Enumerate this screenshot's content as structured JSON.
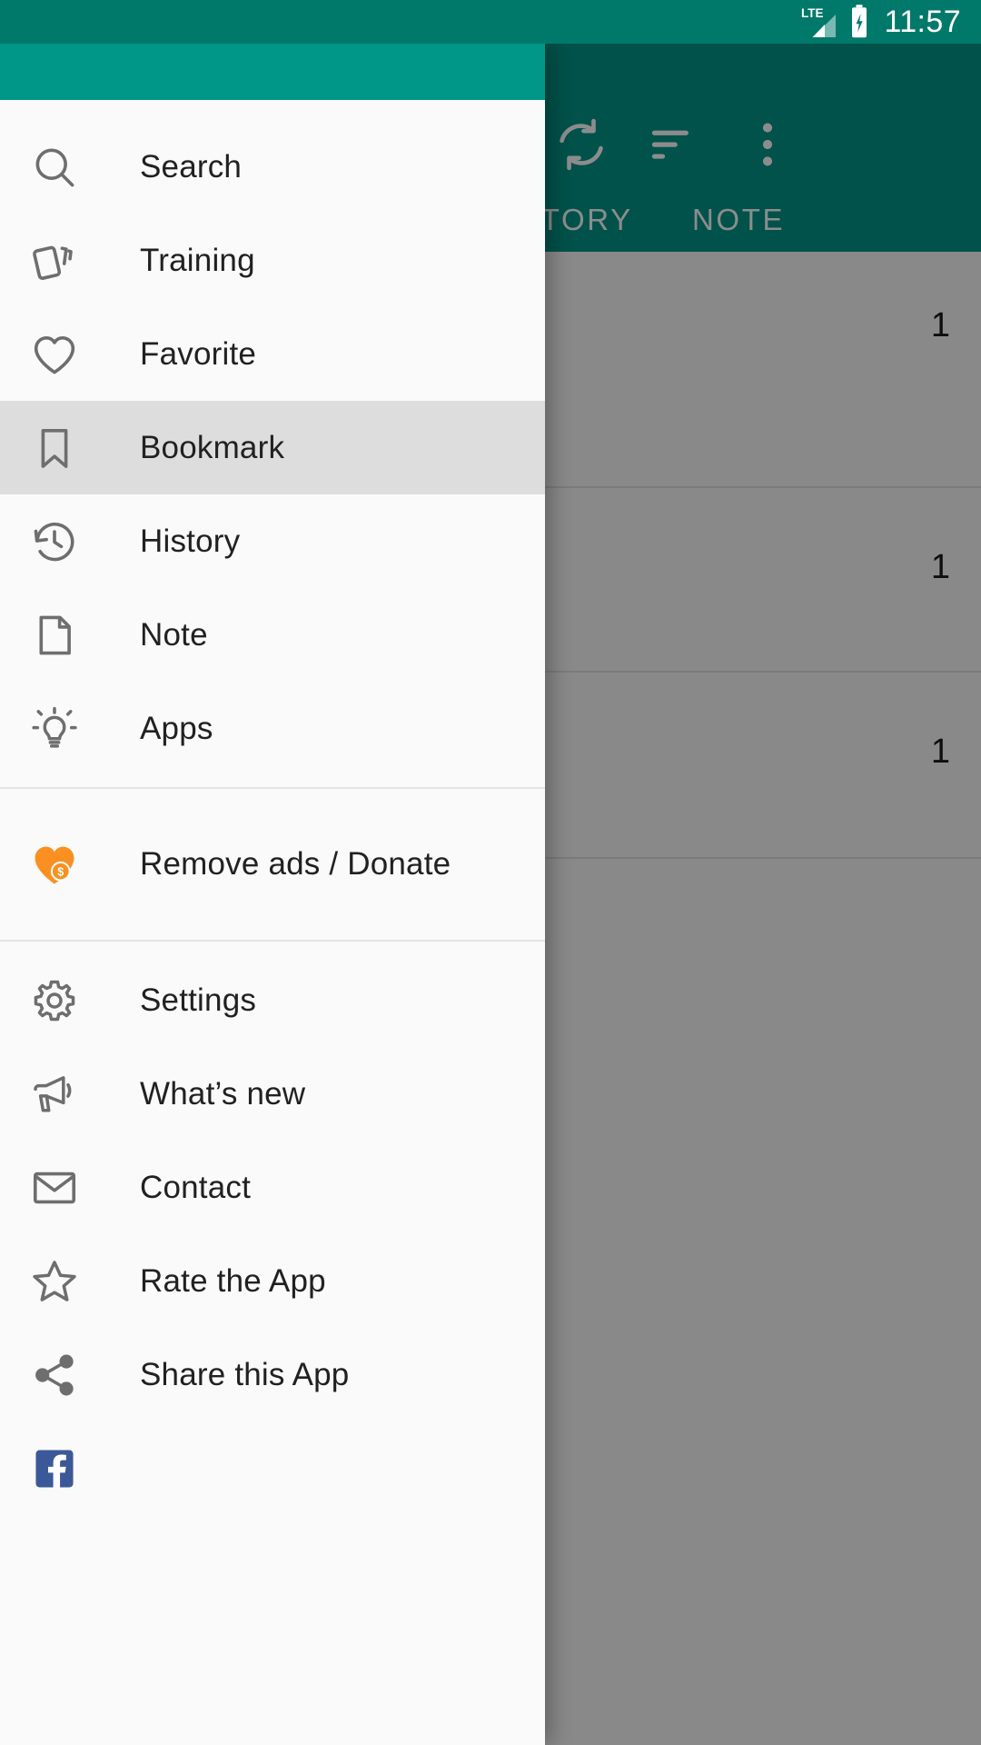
{
  "status_bar": {
    "network_label": "LTE",
    "time": "11:57",
    "icons": [
      "lte-signal-icon",
      "battery-charging-icon"
    ],
    "background_color": "#00796B"
  },
  "app": {
    "accent_color": "#009688",
    "toolbar": {
      "actions": [
        {
          "name": "sync-icon",
          "label": "Sync"
        },
        {
          "name": "sort-icon",
          "label": "Sort"
        },
        {
          "name": "overflow-menu-icon",
          "label": "More options"
        }
      ]
    },
    "tabs": [
      {
        "label": "HISTORY",
        "active": false
      },
      {
        "label": "NOTE",
        "active": false
      }
    ],
    "list_rows": [
      {
        "count": "1"
      },
      {
        "count": "1"
      },
      {
        "count": "1"
      },
      {
        "count": ""
      }
    ]
  },
  "drawer": {
    "header_color": "#009688",
    "background_color": "#FAFAFA",
    "selected_color": "#DDDDDD",
    "groups": [
      {
        "id": "primary",
        "items": [
          {
            "label": "Search",
            "icon": "search-icon",
            "selected": false
          },
          {
            "label": "Training",
            "icon": "cards-icon",
            "selected": false
          },
          {
            "label": "Favorite",
            "icon": "heart-outline-icon",
            "selected": false
          },
          {
            "label": "Bookmark",
            "icon": "bookmark-icon",
            "selected": true
          },
          {
            "label": "History",
            "icon": "history-clock-icon",
            "selected": false
          },
          {
            "label": "Note",
            "icon": "document-icon",
            "selected": false
          },
          {
            "label": "Apps",
            "icon": "lightbulb-icon",
            "selected": false
          }
        ]
      },
      {
        "id": "donate",
        "items": [
          {
            "label": "Remove ads / Donate",
            "icon": "heart-dollar-icon",
            "selected": false,
            "icon_color": "#FA9021"
          }
        ]
      },
      {
        "id": "secondary",
        "items": [
          {
            "label": "Settings",
            "icon": "gear-icon",
            "selected": false
          },
          {
            "label": "What’s new",
            "icon": "megaphone-icon",
            "selected": false
          },
          {
            "label": "Contact",
            "icon": "envelope-icon",
            "selected": false
          },
          {
            "label": "Rate the App",
            "icon": "star-outline-icon",
            "selected": false
          },
          {
            "label": "Share this App",
            "icon": "share-icon",
            "selected": false
          },
          {
            "label": "",
            "icon": "facebook-icon",
            "selected": false,
            "icon_color": "#3B5998",
            "partial": true
          }
        ]
      }
    ]
  }
}
